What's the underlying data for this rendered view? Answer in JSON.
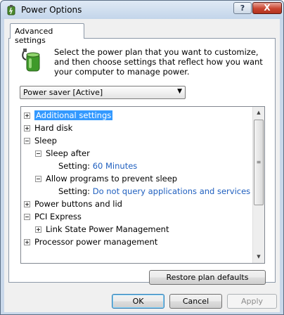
{
  "window": {
    "title": "Power Options",
    "help_glyph": "?",
    "close_glyph": "X"
  },
  "tab": {
    "label": "Advanced settings"
  },
  "description": "Select the power plan that you want to customize, and then choose settings that reflect how you want your computer to manage power.",
  "plan_select": {
    "selected": "Power saver [Active]"
  },
  "tree": {
    "items": [
      {
        "label": "Additional settings",
        "selected": true
      },
      {
        "label": "Hard disk"
      },
      {
        "label": "Sleep"
      },
      {
        "label": "Sleep after"
      },
      {
        "label": "Setting:",
        "value": "60 Minutes"
      },
      {
        "label": "Allow programs to prevent sleep"
      },
      {
        "label": "Setting:",
        "value": "Do not query applications and services"
      },
      {
        "label": "Power buttons and lid"
      },
      {
        "label": "PCI Express"
      },
      {
        "label": "Link State Power Management"
      },
      {
        "label": "Processor power management"
      }
    ]
  },
  "buttons": {
    "restore": "Restore plan defaults",
    "ok": "OK",
    "cancel": "Cancel",
    "apply": "Apply"
  },
  "colors": {
    "selection": "#3399ff",
    "setting_value": "#1f5fbf",
    "close_button": "#c9442f"
  }
}
